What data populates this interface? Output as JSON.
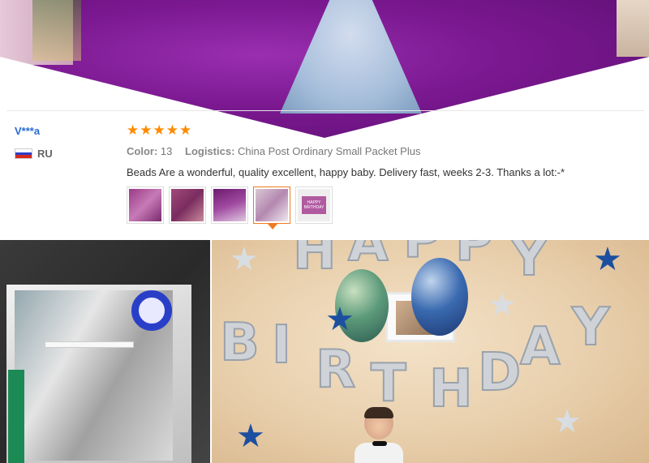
{
  "reviewer": {
    "name": "V***a",
    "country": "RU"
  },
  "review": {
    "rating": 5,
    "rating_max": 5,
    "color_label": "Color:",
    "color_value": "13",
    "logistics_label": "Logistics:",
    "logistics_value": "China Post Ordinary Small Packet Plus",
    "text": "Beads Are a wonderful, quality excellent, happy baby. Delivery fast, weeks 2-3. Thanks a lot:-*",
    "thumbnails": [
      {
        "name": "review-thumbnail-1",
        "active": false
      },
      {
        "name": "review-thumbnail-2",
        "active": false
      },
      {
        "name": "review-thumbnail-3",
        "active": false
      },
      {
        "name": "review-thumbnail-4",
        "active": true
      },
      {
        "name": "review-thumbnail-5",
        "active": false
      }
    ]
  },
  "thumb5_card_text": "HAPPY BIRTHDAY",
  "birthday_letters": [
    "B",
    "I",
    "R",
    "T",
    "H",
    "D",
    "A",
    "Y"
  ],
  "happy_letters": [
    "H",
    "A",
    "P",
    "P",
    "Y"
  ],
  "colors": {
    "accent_orange": "#f07a20",
    "star_color": "#ff8a00",
    "name_blue": "#2a6ad3"
  }
}
